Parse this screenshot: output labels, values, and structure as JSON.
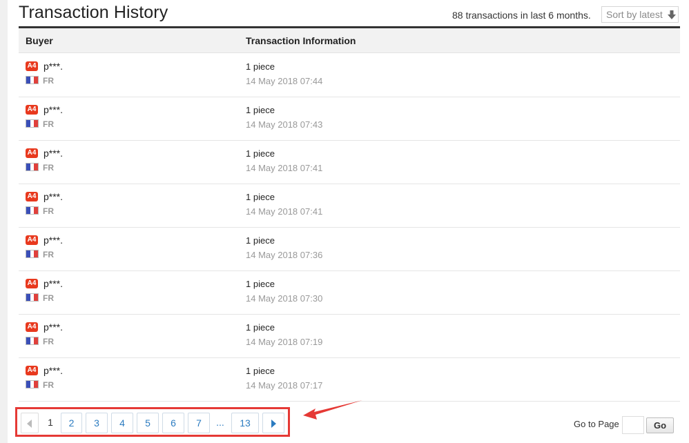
{
  "header": {
    "title": "Transaction History",
    "summary": "88 transactions in last 6 months.",
    "sort_label": "Sort by latest",
    "sort_icon": "arrow-down-icon"
  },
  "table": {
    "columns": [
      "Buyer",
      "Transaction Information"
    ],
    "rows": [
      {
        "badge": "A4",
        "buyer": "p***.",
        "country": "FR",
        "quantity": "1 piece",
        "date": "14 May 2018 07:44"
      },
      {
        "badge": "A4",
        "buyer": "p***.",
        "country": "FR",
        "quantity": "1 piece",
        "date": "14 May 2018 07:43"
      },
      {
        "badge": "A4",
        "buyer": "p***.",
        "country": "FR",
        "quantity": "1 piece",
        "date": "14 May 2018 07:41"
      },
      {
        "badge": "A4",
        "buyer": "p***.",
        "country": "FR",
        "quantity": "1 piece",
        "date": "14 May 2018 07:41"
      },
      {
        "badge": "A4",
        "buyer": "p***.",
        "country": "FR",
        "quantity": "1 piece",
        "date": "14 May 2018 07:36"
      },
      {
        "badge": "A4",
        "buyer": "p***.",
        "country": "FR",
        "quantity": "1 piece",
        "date": "14 May 2018 07:30"
      },
      {
        "badge": "A4",
        "buyer": "p***.",
        "country": "FR",
        "quantity": "1 piece",
        "date": "14 May 2018 07:19"
      },
      {
        "badge": "A4",
        "buyer": "p***.",
        "country": "FR",
        "quantity": "1 piece",
        "date": "14 May 2018 07:17"
      }
    ]
  },
  "pagination": {
    "current": "1",
    "pages": [
      "2",
      "3",
      "4",
      "5",
      "6",
      "7"
    ],
    "ellipsis": "...",
    "last": "13",
    "prev_icon": "chevron-left-icon",
    "next_icon": "chevron-right-icon",
    "goto_label": "Go to Page",
    "goto_value": "",
    "go_label": "Go"
  },
  "colors": {
    "badge": "#e8391e",
    "link": "#2b7bc0",
    "highlight_box": "#e53935",
    "flag_blue": "#3a4fb8",
    "flag_red": "#e0403c"
  }
}
